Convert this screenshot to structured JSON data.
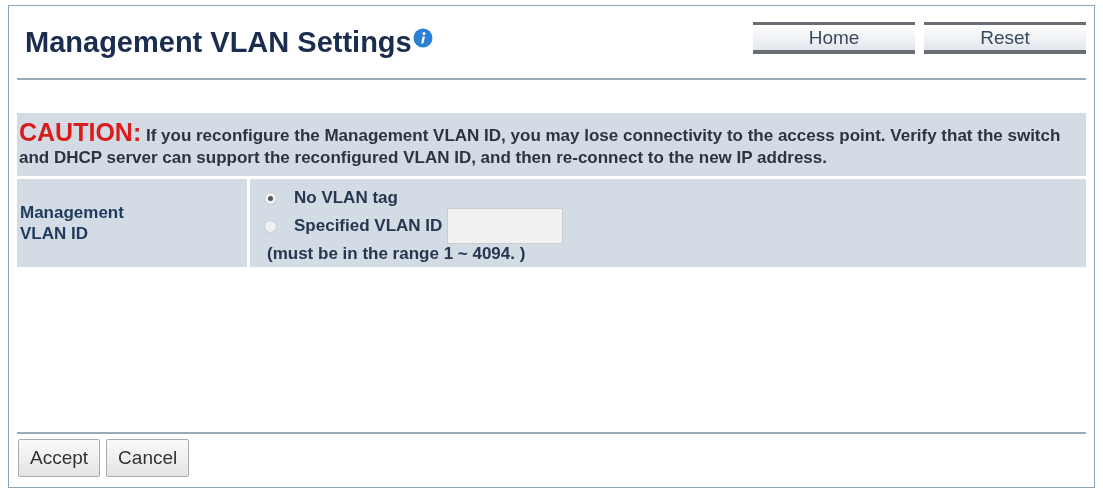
{
  "title": "Management VLAN Settings",
  "header_buttons": [
    "Home",
    "Reset"
  ],
  "caution": {
    "label": "CAUTION:",
    "text": "If you reconfigure the Management VLAN ID, you may lose connectivity to the access point. Verify that the switch and DHCP server can support the reconfigured VLAN ID, and then re-connect to the new IP address."
  },
  "setting": {
    "label": "Management VLAN ID",
    "options": [
      {
        "label": "No VLAN tag",
        "selected": true,
        "kind": "plain"
      },
      {
        "label": "Specified VLAN ID",
        "selected": false,
        "kind": "with_field"
      }
    ],
    "hint": "(must be in the range 1 ~ 4094. )"
  },
  "buttons": [
    "Accept",
    "Cancel"
  ]
}
